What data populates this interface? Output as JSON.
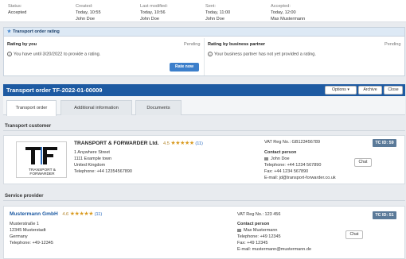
{
  "status": {
    "status_label": "Status:",
    "status_value": "Accepted",
    "created_label": "Created:",
    "created_date": "Today, 10:55",
    "created_by": "John Doe",
    "modified_label": "Last modified:",
    "modified_date": "Today, 10:56",
    "modified_by": "John Doe",
    "sent_label": "Sent:",
    "sent_date": "Today, 11:00",
    "sent_by": "John Doe",
    "accepted_label": "Accepted:",
    "accepted_date": "Today, 12:00",
    "accepted_by": "Max Mustermann"
  },
  "rating": {
    "header": "Transport order rating",
    "by_you_title": "Rating by you",
    "by_you_status": "Pending",
    "by_you_msg": "You have until 3/20/2022 to provide a rating.",
    "by_partner_title": "Rating by business partner",
    "by_partner_status": "Pending",
    "by_partner_msg": "Your business partner has not yet provided a rating.",
    "rate_button": "Rate now"
  },
  "order": {
    "title": "Transport order TF-2022-01-00009",
    "options_button": "Options",
    "archive_button": "Archive",
    "close_button": "Close"
  },
  "tabs": [
    "Transport order",
    "Additional information",
    "Documents"
  ],
  "customer": {
    "section_title": "Transport customer",
    "logo_text": "TRANSPORT & FORWARDER",
    "name": "TRANSPORT & FORWARDER Ltd.",
    "rating": "4.5",
    "stars": "★★★★★",
    "count": "(11)",
    "address1": "1 Anywhere Street",
    "address2": "1111 Example town",
    "country": "United Kingdom",
    "telephone": "Telephone: +44 12354567890",
    "vat": "VAT Reg No.: GB123456789",
    "tc_id": "TC ID: 59",
    "contact_label": "Contact person",
    "contact_name": "John Doe",
    "contact_tel": "Telephone: +44 1234 567890",
    "contact_fax": "Fax: +44 1234 567890",
    "contact_email": "E-mail: jd@transport-forwarder.co.uk",
    "chat_button": "Chat"
  },
  "provider": {
    "section_title": "Service provider",
    "name": "Mustermann GmbH",
    "rating": "4.6",
    "stars": "★★★★★",
    "count": "(11)",
    "address1": "Musterstraße 1",
    "address2": "12345 Musterstadt",
    "country": "Germany",
    "telephone": "Telephone: +49-12345",
    "vat": "VAT Reg No.: 123 456",
    "tc_id": "TC ID: 51",
    "contact_label": "Contact person",
    "contact_name": "Max Mustermann",
    "contact_tel": "Telephone: +49 12345",
    "contact_fax": "Fax: +49 12345",
    "contact_email": "E-mail: mustermann@mustermann.de",
    "chat_button": "Chat"
  },
  "colors": {
    "brand": "#1d5aa2",
    "accent_button": "#3c7fcb",
    "star": "#d99a1f",
    "badge": "#5b7a99"
  },
  "icons": {
    "star_header": "star-icon",
    "info": "info-icon",
    "person": "person-icon",
    "dropdown": "caret-down-icon"
  }
}
